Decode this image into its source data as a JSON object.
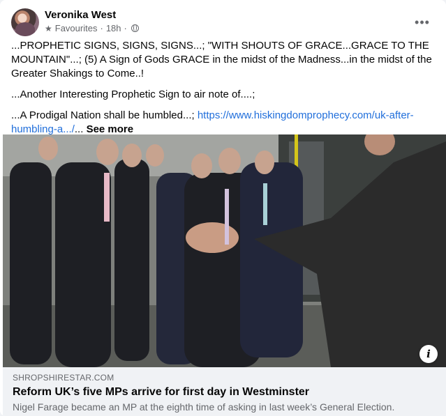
{
  "post": {
    "author": "Veronika West",
    "audience": "Favourites",
    "separator": "·",
    "time": "18h",
    "paragraphs": [
      "...PROPHETIC SIGNS, SIGNS, SIGNS...; \"WITH SHOUTS OF GRACE...GRACE TO THE MOUNTAIN\"...; (5) A Sign of Gods GRACE in the midst of the Madness...in the midst of the Greater Shakings to Come..!",
      "...Another Interesting Prophetic Sign to air note of....;"
    ],
    "last_paragraph_prefix": "...A Prodigal Nation shall be humbled...; ",
    "link_text": "https://www.hiskingdomprophecy.com/uk-after-humbling-a.../",
    "ellipsis": "...",
    "see_more": "See more"
  },
  "link_preview": {
    "domain": "SHROPSHIRESTAR.COM",
    "title": "Reform UK’s five MPs arrive for first day in Westminster",
    "description": "Nigel Farage became an MP at the eighth time of asking in last week’s General Election.",
    "info_icon": "i"
  },
  "icons": {
    "audience": "star-icon",
    "privacy": "globe-icon",
    "menu": "more-options-icon"
  }
}
